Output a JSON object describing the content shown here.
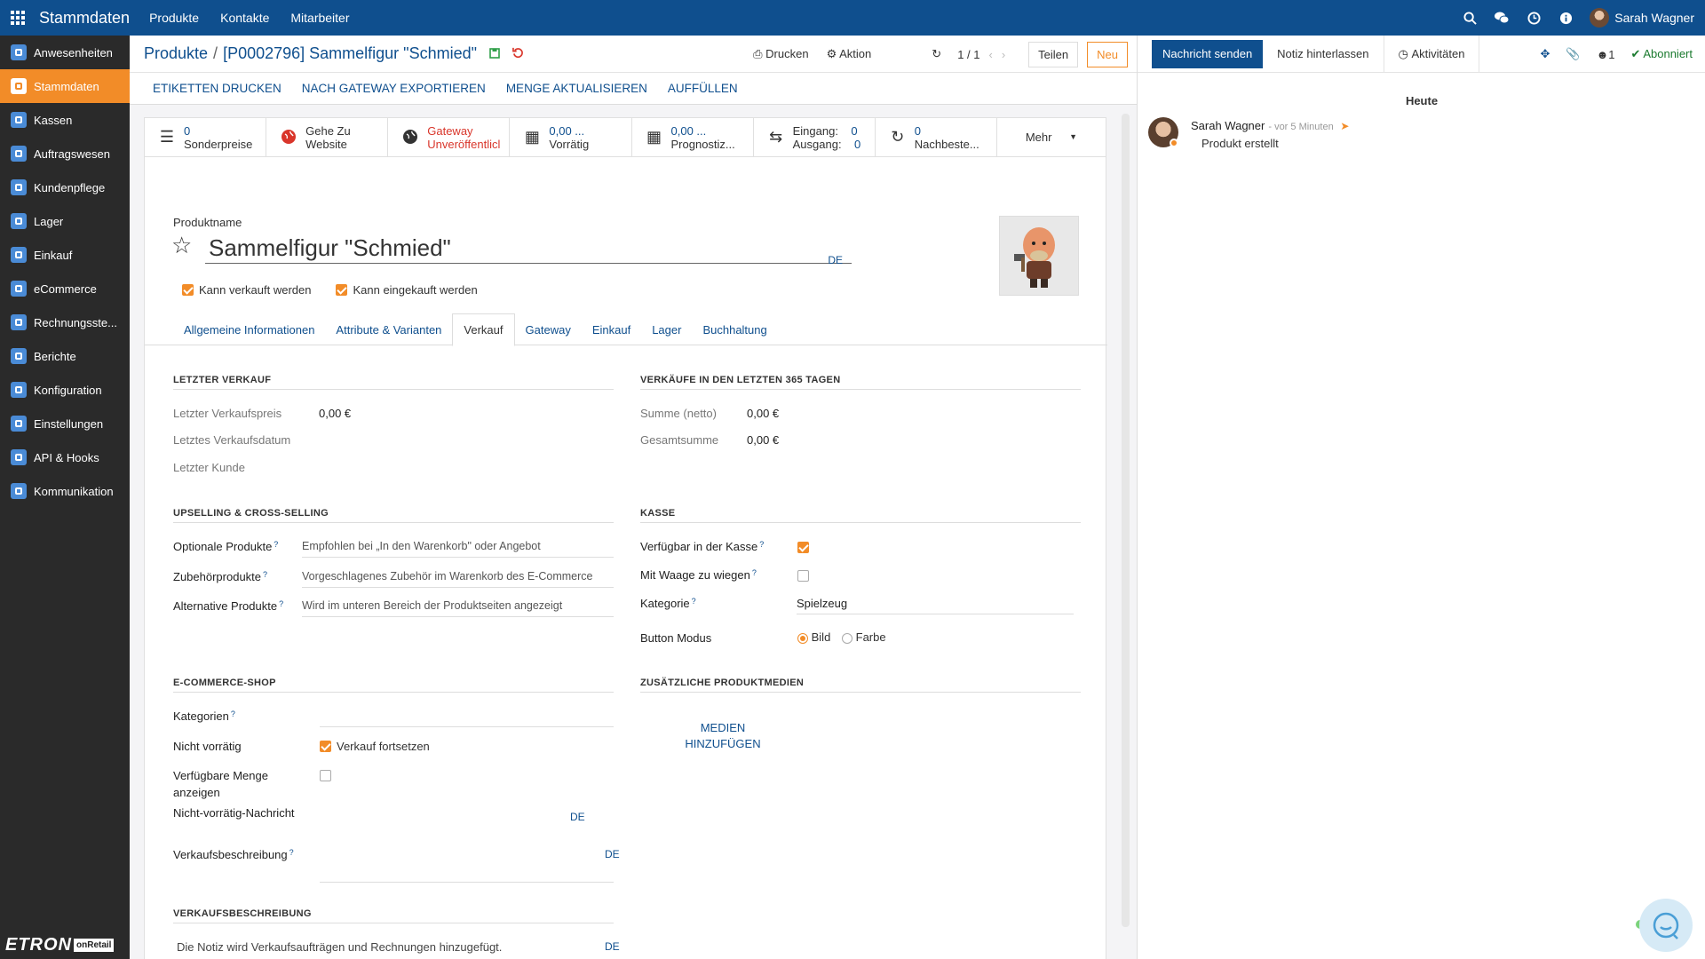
{
  "topbar": {
    "app_title": "Stammdaten",
    "nav": [
      "Produkte",
      "Kontakte",
      "Mitarbeiter"
    ],
    "user_name": "Sarah Wagner"
  },
  "sidebar": {
    "items": [
      {
        "label": "Anwesenheiten",
        "icon": "calendar-icon"
      },
      {
        "label": "Stammdaten",
        "icon": "master-data-icon"
      },
      {
        "label": "Kassen",
        "icon": "register-icon"
      },
      {
        "label": "Auftragswesen",
        "icon": "chart-icon"
      },
      {
        "label": "Kundenpflege",
        "icon": "people-icon"
      },
      {
        "label": "Lager",
        "icon": "box-icon"
      },
      {
        "label": "Einkauf",
        "icon": "cart-icon"
      },
      {
        "label": "eCommerce",
        "icon": "globe-icon"
      },
      {
        "label": "Rechnungsste...",
        "icon": "invoice-icon"
      },
      {
        "label": "Berichte",
        "icon": "dashboard-icon"
      },
      {
        "label": "Konfiguration",
        "icon": "config-icon"
      },
      {
        "label": "Einstellungen",
        "icon": "gear-icon"
      },
      {
        "label": "API & Hooks",
        "icon": "api-icon"
      },
      {
        "label": "Kommunikation",
        "icon": "chat-icon"
      }
    ],
    "active_index": 1,
    "logo_main": "ETRON",
    "logo_sub": "onRetail"
  },
  "control_panel": {
    "breadcrumb_parent": "Produkte",
    "breadcrumb_current": "[P0002796] Sammelfigur \"Schmied\"",
    "print_label": "Drucken",
    "action_label": "Aktion",
    "pager": "1 / 1",
    "share_label": "Teilen",
    "new_label": "Neu"
  },
  "actions": [
    "ETIKETTEN DRUCKEN",
    "NACH GATEWAY EXPORTIEREN",
    "MENGE AKTUALISIEREN",
    "AUFFÜLLEN"
  ],
  "smart_buttons": [
    {
      "icon": "list-icon",
      "line1": "0",
      "line2": "Sonderpreise"
    },
    {
      "icon": "globe-icon",
      "line1": "Gehe Zu",
      "line2": "Website"
    },
    {
      "icon": "globe-icon",
      "line1": "Gateway",
      "line2": "Unveröffentlicl"
    },
    {
      "icon": "cubes-icon",
      "line1": "0,00 ...",
      "line2": "Vorrätig"
    },
    {
      "icon": "cubes-icon",
      "line1": "0,00 ...",
      "line2": "Prognostiz..."
    },
    {
      "icon": "exchange-icon",
      "line1": "Eingang:",
      "line1b": "0",
      "line2": "Ausgang:",
      "line2b": "0"
    },
    {
      "icon": "refresh-icon",
      "line1": "0",
      "line2": "Nachbeste..."
    },
    {
      "label": "Mehr"
    }
  ],
  "product": {
    "name_label": "Produktname",
    "name": "Sammelfigur \"Schmied\"",
    "lang": "DE",
    "can_be_sold_label": "Kann verkauft werden",
    "can_be_purchased_label": "Kann eingekauft werden"
  },
  "tabs": [
    "Allgemeine Informationen",
    "Attribute & Varianten",
    "Verkauf",
    "Gateway",
    "Einkauf",
    "Lager",
    "Buchhaltung"
  ],
  "active_tab": 2,
  "sales": {
    "last_sale_title": "LETZTER VERKAUF",
    "last_price_label": "Letzter Verkaufspreis",
    "last_price_value": "0,00 €",
    "last_date_label": "Letztes Verkaufsdatum",
    "last_customer_label": "Letzter Kunde",
    "sales365_title": "VERKÄUFE IN DEN LETZTEN 365 TAGEN",
    "sum_net_label": "Summe (netto)",
    "sum_net_value": "0,00 €",
    "total_label": "Gesamtsumme",
    "total_value": "0,00 €",
    "upsell_title": "UPSELLING & CROSS-SELLING",
    "optional_label": "Optionale Produkte",
    "optional_placeholder": "Empfohlen bei „In den Warenkorb\" oder Angebot",
    "accessory_label": "Zubehörprodukte",
    "accessory_placeholder": "Vorgeschlagenes Zubehör im Warenkorb des E-Commerce",
    "alternative_label": "Alternative Produkte",
    "alternative_placeholder": "Wird im unteren Bereich der Produktseiten angezeigt",
    "pos_title": "KASSE",
    "pos_available_label": "Verfügbar in der Kasse",
    "pos_scale_label": "Mit Waage zu wiegen",
    "pos_category_label": "Kategorie",
    "pos_category_value": "Spielzeug",
    "button_mode_label": "Button Modus",
    "button_mode_image": "Bild",
    "button_mode_color": "Farbe",
    "ecom_title": "E-COMMERCE-SHOP",
    "categories_label": "Kategorien",
    "out_of_stock_label": "Nicht vorrätig",
    "continue_selling_label": "Verkauf fortsetzen",
    "show_qty_label": "Verfügbare Menge anzeigen",
    "oos_message_label": "Nicht-vorrätig-Nachricht",
    "sales_desc_label": "Verkaufsbeschreibung",
    "media_title": "ZUSÄTZLICHE PRODUKTMEDIEN",
    "add_media_label": "MEDIEN HINZUFÜGEN",
    "desc_title": "VERKAUFSBESCHREIBUNG",
    "desc_placeholder": "Die Notiz wird Verkaufsaufträgen und Rechnungen hinzugefügt.",
    "lang": "DE",
    "help": "?"
  },
  "chatter": {
    "send_message": "Nachricht senden",
    "log_note": "Notiz hinterlassen",
    "activities": "Aktivitäten",
    "followers_count": "1",
    "subscribed": "Abonniert",
    "today": "Heute",
    "message_author": "Sarah Wagner",
    "message_time": "- vor 5 Minuten",
    "message_body": "Produkt erstellt"
  },
  "colors": {
    "primary": "#0f4f8e",
    "accent": "#f28c28",
    "sidebar": "#2a2a2a"
  }
}
